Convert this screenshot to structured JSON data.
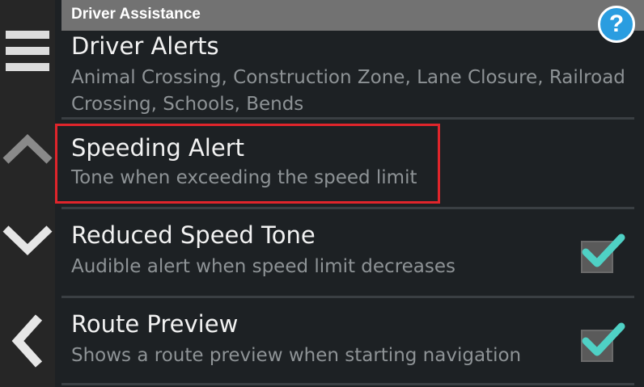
{
  "header": {
    "title": "Driver Assistance",
    "help_label": "?"
  },
  "sidebar": {
    "menu_icon": "hamburger-menu-icon",
    "up_icon": "chevron-up-icon",
    "down_icon": "chevron-down-icon",
    "back_icon": "chevron-left-icon"
  },
  "settings": [
    {
      "title": "Driver Alerts",
      "subtitle": "Animal Crossing, Construction Zone, Lane Closure, Railroad Crossing, Schools, Bends",
      "has_checkbox": false
    },
    {
      "title": "Speeding Alert",
      "subtitle": "Tone when exceeding the speed limit",
      "has_checkbox": false,
      "highlighted": true
    },
    {
      "title": "Reduced Speed Tone",
      "subtitle": "Audible alert when speed limit decreases",
      "has_checkbox": true,
      "checked": true
    },
    {
      "title": "Route Preview",
      "subtitle": "Shows a route preview when starting navigation",
      "has_checkbox": true,
      "checked": true
    }
  ],
  "colors": {
    "accent_check": "#4fd1c5",
    "help_blue": "#2a9de0",
    "highlight_red": "#e0252b",
    "header_gray": "#727272"
  }
}
